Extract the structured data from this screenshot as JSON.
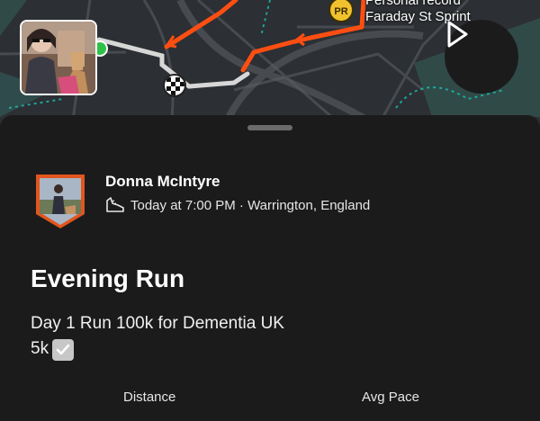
{
  "map": {
    "pr_line1": "Personal record",
    "pr_line2": "Faraday St Sprint",
    "pr_badge": "PR",
    "colors": {
      "route": "#ff4e12",
      "road": "#cfcfcf",
      "green": "#19c2b3"
    }
  },
  "activity": {
    "athlete_name": "Donna McIntyre",
    "datetime_location": "Today at 7:00 PM · Warrington, England",
    "title": "Evening Run",
    "description_line1": "Day 1 Run 100k for Dementia UK",
    "description_line2": "5k"
  },
  "stats": {
    "distance_label": "Distance",
    "avg_pace_label": "Avg Pace"
  },
  "icons": [
    "play-icon",
    "shoe-icon",
    "checkbox-icon",
    "pr-medal-icon",
    "finish-flag-icon"
  ]
}
